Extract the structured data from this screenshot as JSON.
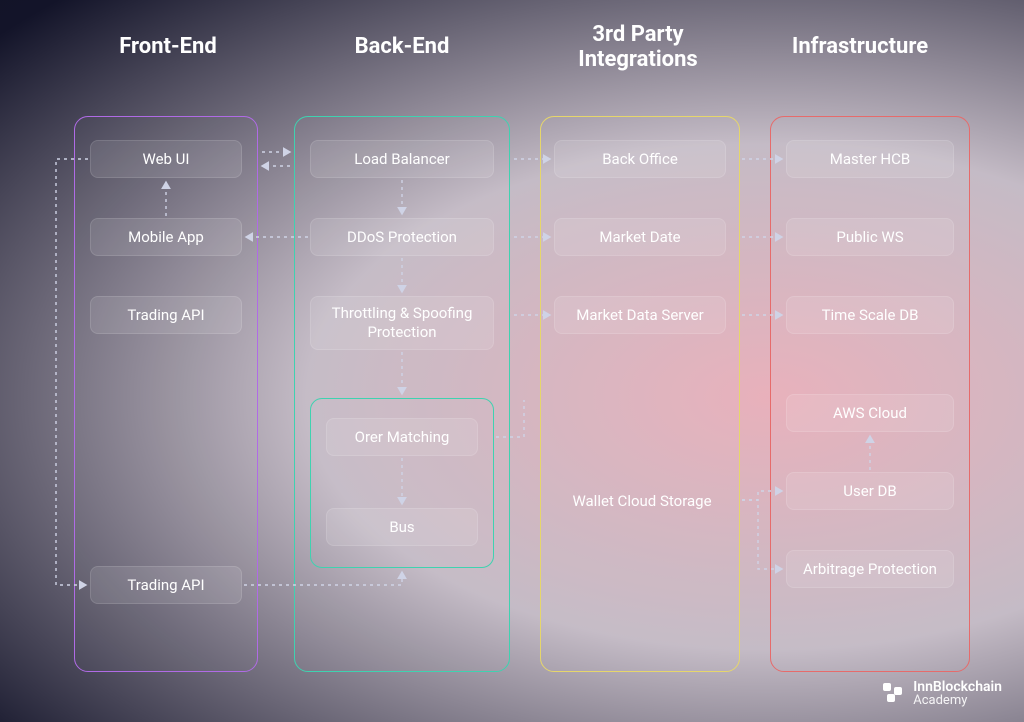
{
  "columns": {
    "frontend": {
      "title": "Front-End",
      "border": "#b06be6"
    },
    "backend": {
      "title": "Back-End",
      "border": "#3fd2b0"
    },
    "thirdparty": {
      "title": "3rd Party Integrations",
      "border": "#e6d66b"
    },
    "infra": {
      "title": "Infrastructure",
      "border": "#e66b6b"
    }
  },
  "nodes": {
    "webui": "Web UI",
    "mobile": "Mobile App",
    "tradingapi1": "Trading API",
    "tradingapi2": "Trading API",
    "loadbalancer": "Load Balancer",
    "ddos": "DDoS Protection",
    "throttle": "Throttling & Spoofing Protection",
    "ordermatch": "Orer Matching",
    "bus": "Bus",
    "backoffice": "Back Office",
    "marketdate": "Market Date",
    "marketdataserver": "Market Data Server",
    "walletcloud": "Wallet Cloud Storage",
    "masterhcb": "Master HCB",
    "publicws": "Public WS",
    "timescaledb": "Time Scale DB",
    "awscloud": "AWS Cloud",
    "userdb": "User DB",
    "arbitrage": "Arbitrage Protection"
  },
  "logo": {
    "line1": "InnBlockchain",
    "line2": "Academy"
  }
}
